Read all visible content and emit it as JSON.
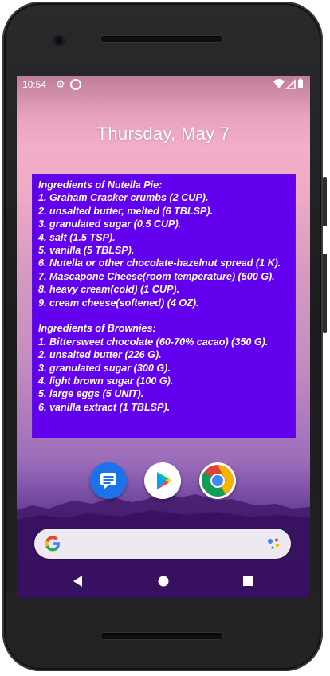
{
  "status_bar": {
    "time": "10:54",
    "icons": [
      "gear-icon",
      "sync-icon",
      "wifi-icon",
      "signal-icon",
      "battery-icon"
    ]
  },
  "lockscreen": {
    "date": "Thursday, May 7"
  },
  "widget": {
    "background": "#6200ee",
    "text_color": "#ffffff",
    "sections": [
      {
        "heading": "Ingredients of Nutella Pie:",
        "items": [
          "1. Graham Cracker crumbs (2 CUP).",
          "2. unsalted butter, melted (6 TBLSP).",
          "3. granulated sugar (0.5 CUP).",
          "4. salt (1.5 TSP).",
          "5. vanilla (5 TBLSP).",
          "6. Nutella or other chocolate-hazelnut spread (1 K).",
          "7. Mascapone Cheese(room temperature) (500 G).",
          "8. heavy cream(cold) (1 CUP).",
          "9. cream cheese(softened) (4 OZ)."
        ]
      },
      {
        "heading": "Ingredients of Brownies:",
        "items": [
          "1. Bittersweet chocolate (60-70% cacao) (350 G).",
          "2. unsalted butter (226 G).",
          "3. granulated sugar (300 G).",
          "4. light brown sugar (100 G).",
          "5. large eggs (5 UNIT).",
          "6. vanilla extract (1 TBLSP)."
        ]
      }
    ]
  },
  "dock": {
    "apps": [
      "messages-icon",
      "play-store-icon",
      "chrome-icon"
    ]
  },
  "search": {
    "icons": [
      "google-g-icon",
      "assistant-icon"
    ]
  },
  "navigation": {
    "buttons": [
      "back-button",
      "home-button",
      "recents-button"
    ]
  }
}
